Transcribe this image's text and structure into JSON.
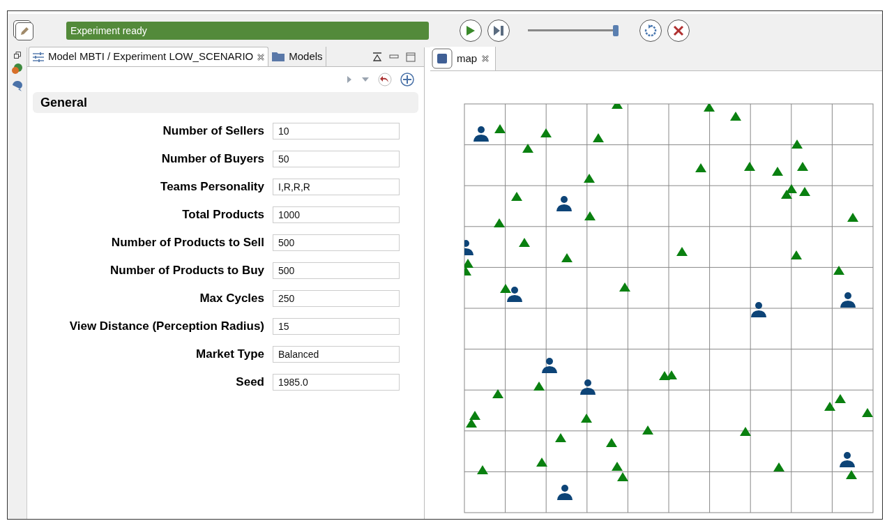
{
  "toolbar": {
    "status": "Experiment ready",
    "speed_slider": {
      "level": 1.0
    }
  },
  "left_tabs": [
    {
      "label": "Model MBTI / Experiment LOW_SCENARIO",
      "kind": "experiment",
      "selected": true,
      "closable": true
    },
    {
      "label": "Models",
      "kind": "folder",
      "selected": false,
      "closable": false
    }
  ],
  "section": {
    "title": "General"
  },
  "parameters": [
    {
      "label": "Number of Sellers",
      "value": "10"
    },
    {
      "label": "Number of Buyers",
      "value": "50"
    },
    {
      "label": "Teams Personality",
      "value": "I,R,R,R"
    },
    {
      "label": "Total Products",
      "value": "1000"
    },
    {
      "label": "Number of Products to Sell",
      "value": "500"
    },
    {
      "label": "Number of Products to Buy",
      "value": "500"
    },
    {
      "label": "Max Cycles",
      "value": "250"
    },
    {
      "label": "View Distance (Perception Radius)",
      "value": "15"
    },
    {
      "label": "Market Type",
      "value": "Balanced"
    },
    {
      "label": "Seed",
      "value": "1985.0"
    }
  ],
  "right_tabs": [
    {
      "label": "map",
      "selected": true
    }
  ]
}
